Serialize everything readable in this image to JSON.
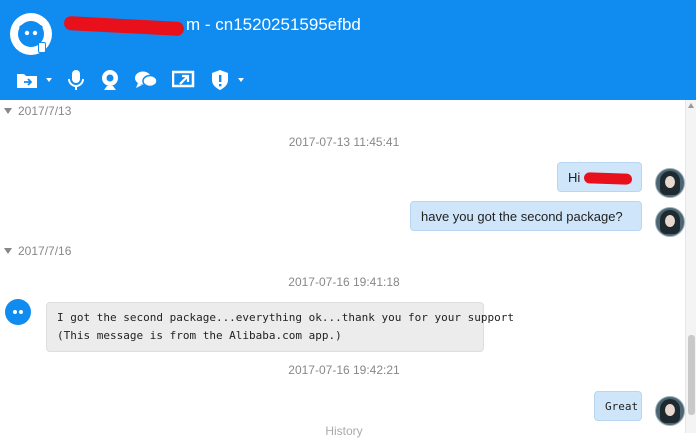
{
  "window": {
    "title_suffix": "m - cn1520251595efbd"
  },
  "toolbar": {
    "items": [
      "folder-menu-icon",
      "microphone-icon",
      "webcam-icon",
      "chat-bubbles-icon",
      "screen-share-icon",
      "shield-icon"
    ]
  },
  "conversation": {
    "groups": [
      {
        "date": "2017/7/13",
        "timestamp": "2017-07-13 11:45:41",
        "messages": [
          {
            "from": "me",
            "text": "Hi "
          },
          {
            "from": "me",
            "text": "have you got the second package?"
          }
        ]
      },
      {
        "date": "2017/7/16",
        "timestamp": "2017-07-16 19:41:18",
        "messages": [
          {
            "from": "contact",
            "line1": "I got the second package...everything ok...thank you for your support",
            "line2": "(This message is from the Alibaba.com app.)"
          }
        ],
        "timestamp2": "2017-07-16 19:42:21",
        "messages2": [
          {
            "from": "me",
            "text": "Great"
          }
        ]
      }
    ],
    "history_label": "History"
  },
  "colors": {
    "header": "#108bf0",
    "outgoing_bubble": "#cfe5fa",
    "incoming_bubble": "#ececec"
  }
}
